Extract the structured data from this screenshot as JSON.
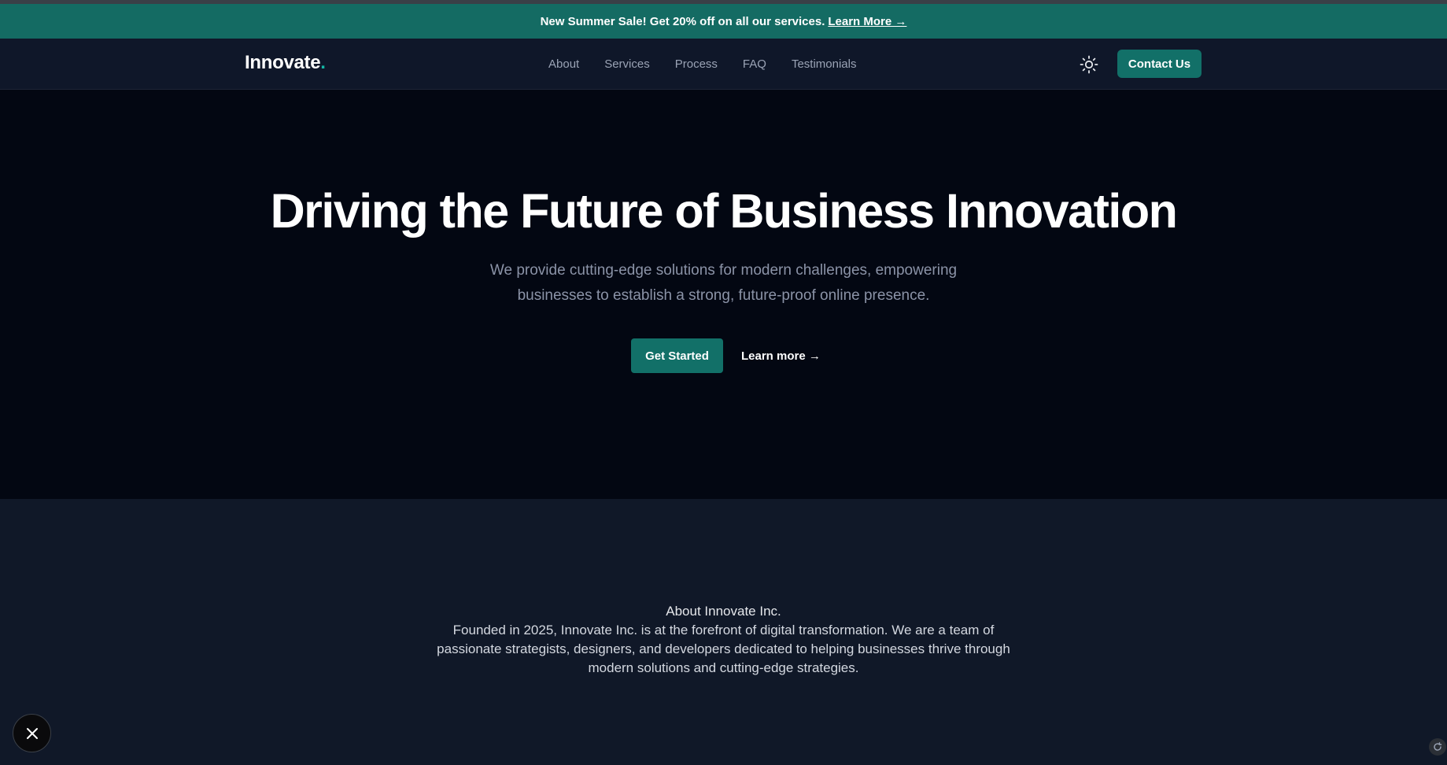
{
  "banner": {
    "text": "New Summer Sale! Get 20% off on all our services.",
    "link": "Learn More →"
  },
  "nav": {
    "logo": "Innovate",
    "logo_dot": ".",
    "links": [
      "About",
      "Services",
      "Process",
      "FAQ",
      "Testimonials"
    ],
    "contact_label": "Contact Us",
    "theme_icon": "sun-icon"
  },
  "hero": {
    "title": "Driving the Future of Business Innovation",
    "subtitle": "We provide cutting-edge solutions for modern challenges, empowering businesses to establish a strong, future-proof online presence.",
    "primary_cta": "Get Started",
    "secondary_cta": "Learn more →"
  },
  "about": {
    "title": "About Innovate Inc.",
    "text": "Founded in 2025, Innovate Inc. is at the forefront of digital transformation. We are a team of passionate strategists, designers, and developers dedicated to helping businesses thrive through modern solutions and cutting-edge strategies."
  },
  "widgets": {
    "close_icon": "close-icon",
    "refresh_icon": "refresh-icon"
  },
  "colors": {
    "accent": "#127068",
    "banner": "#146b63",
    "hero_bg": "#030712",
    "section_bg": "#101828"
  }
}
